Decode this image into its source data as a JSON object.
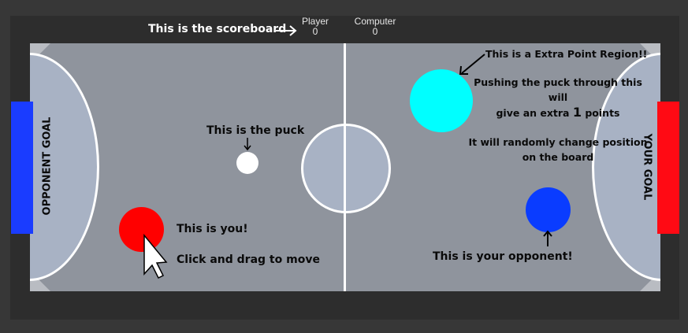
{
  "scoreboard": {
    "caption": "This is the scoreboard",
    "player_label": "Player",
    "player_score": "0",
    "computer_label": "Computer",
    "computer_score": "0"
  },
  "annotations": {
    "puck": "This is the puck",
    "you": "This is you!",
    "drag": "Click and drag to move",
    "opponent": "This is your opponent!",
    "extra_title": "This is a Extra Point Region!!",
    "extra_line1": "Pushing the puck through this will",
    "extra_line2_pre": "give an extra ",
    "extra_points": "1",
    "extra_line2_post": " points",
    "extra_line3": "It will randomly change position",
    "extra_line4": "on the board"
  },
  "goals": {
    "left": "OPPONENT GOAL",
    "right": "YOUR GOAL"
  },
  "colors": {
    "player": "#ff0000",
    "opponent": "#0a3cff",
    "puck": "#ffffff",
    "extra_region": "#00ffff",
    "left_goal": "#1a3cff",
    "right_goal": "#ff0a14"
  },
  "icons": {
    "cursor": "mouse-pointer-icon",
    "arrows": "arrow-icon"
  }
}
